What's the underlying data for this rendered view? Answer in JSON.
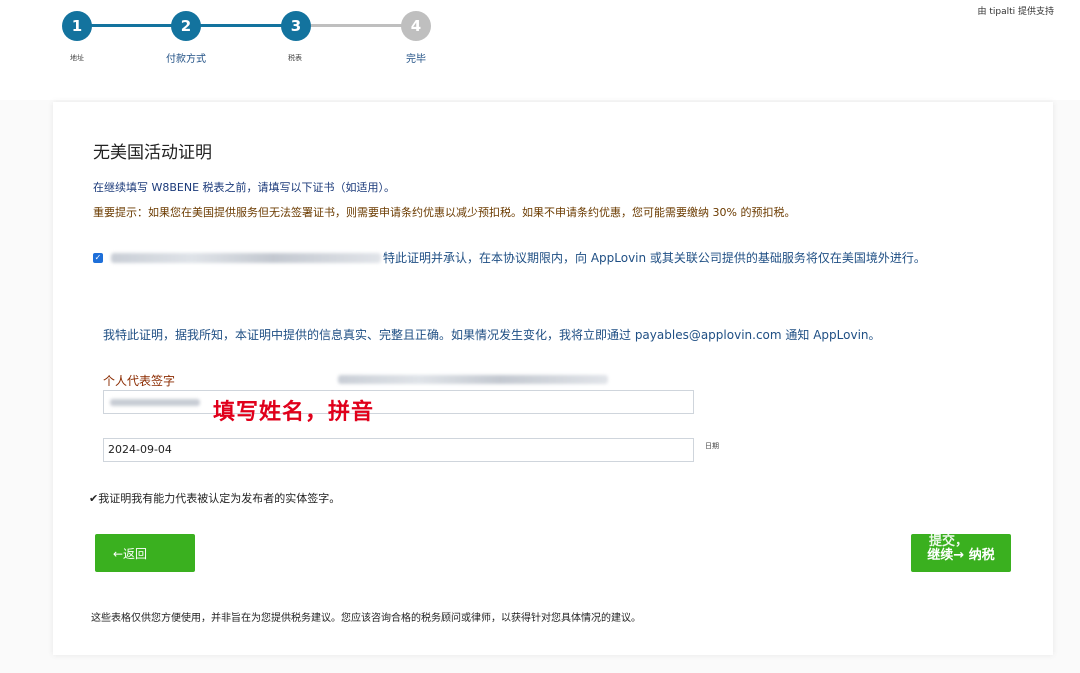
{
  "header": {
    "powered_by": "由 tipalti 提供支持"
  },
  "steps": [
    {
      "number": "1",
      "label": "地址",
      "state": "done"
    },
    {
      "number": "2",
      "label": "付款方式",
      "state": "done"
    },
    {
      "number": "3",
      "label": "税表",
      "state": "current"
    },
    {
      "number": "4",
      "label": "完毕",
      "state": "pending"
    }
  ],
  "colors": {
    "step_active": "#13739e",
    "step_pending": "#bfbfbf",
    "button_green": "#3ab01f",
    "annotation_red": "#e0001b"
  },
  "form": {
    "title": "无美国活动证明",
    "intro": "在继续填写 W8BENE 税表之前，请填写以下证书（如适用）。",
    "notice": "重要提示：如果您在美国提供服务但无法签署证书，则需要申请条约优惠以减少预扣税。如果不申请条约优惠，您可能需要缴纳 30% 的预扣税。",
    "certification_checked": true,
    "certification_text": "特此证明并承认，在本协议期限内，向 AppLovin 或其关联公司提供的基础服务将仅在美国境外进行。",
    "declaration": "我特此证明，据我所知，本证明中提供的信息真实、完整且正确。如果情况发生变化，我将立即通过 payables@applovin.com 通知 AppLovin。",
    "signature_label": "个人代表签字",
    "annotation": "填写姓名，拼音",
    "date_value": "2024-09-04",
    "date_label": "日期",
    "capacity_text": "✔我证明我有能力代表被认定为发布者的实体签字。"
  },
  "buttons": {
    "back_label": "←返回",
    "next_label": "继续→ 纳税",
    "next_overlay": "提交，"
  },
  "footer": {
    "disclaimer": "这些表格仅供您方便使用，并非旨在为您提供税务建议。您应该咨询合格的税务顾问或律师，以获得针对您具体情况的建议。"
  }
}
